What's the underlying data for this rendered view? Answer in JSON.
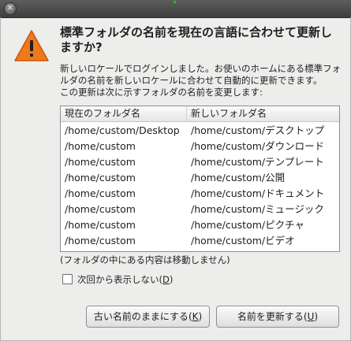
{
  "dialog": {
    "heading": "標準フォルダの名前を現在の言語に合わせて更新しますか?",
    "message": "新しいロケールでログインしました。お使いのホームにある標準フォルダの名前を新しいロケールに合わせて自動的に更新できます。\nこの更新は次に示すフォルダの名前を変更します:",
    "icon": "warning-icon",
    "accent_color": "#f07a1a"
  },
  "table": {
    "headers": [
      "現在のフォルダ名",
      "新しいフォルダ名"
    ],
    "rows": [
      [
        "/home/custom/Desktop",
        "/home/custom/デスクトップ"
      ],
      [
        "/home/custom",
        "/home/custom/ダウンロード"
      ],
      [
        "/home/custom",
        "/home/custom/テンプレート"
      ],
      [
        "/home/custom",
        "/home/custom/公開"
      ],
      [
        "/home/custom",
        "/home/custom/ドキュメント"
      ],
      [
        "/home/custom",
        "/home/custom/ミュージック"
      ],
      [
        "/home/custom",
        "/home/custom/ピクチャ"
      ],
      [
        "/home/custom",
        "/home/custom/ビデオ"
      ]
    ]
  },
  "note": "(フォルダの中にある内容は移動しません)",
  "checkbox": {
    "label": "次回から表示しない",
    "mnemonic": "D",
    "checked": false
  },
  "buttons": {
    "keep": {
      "label": "古い名前のままにする",
      "mnemonic": "K"
    },
    "update": {
      "label": "名前を更新する",
      "mnemonic": "U"
    }
  }
}
